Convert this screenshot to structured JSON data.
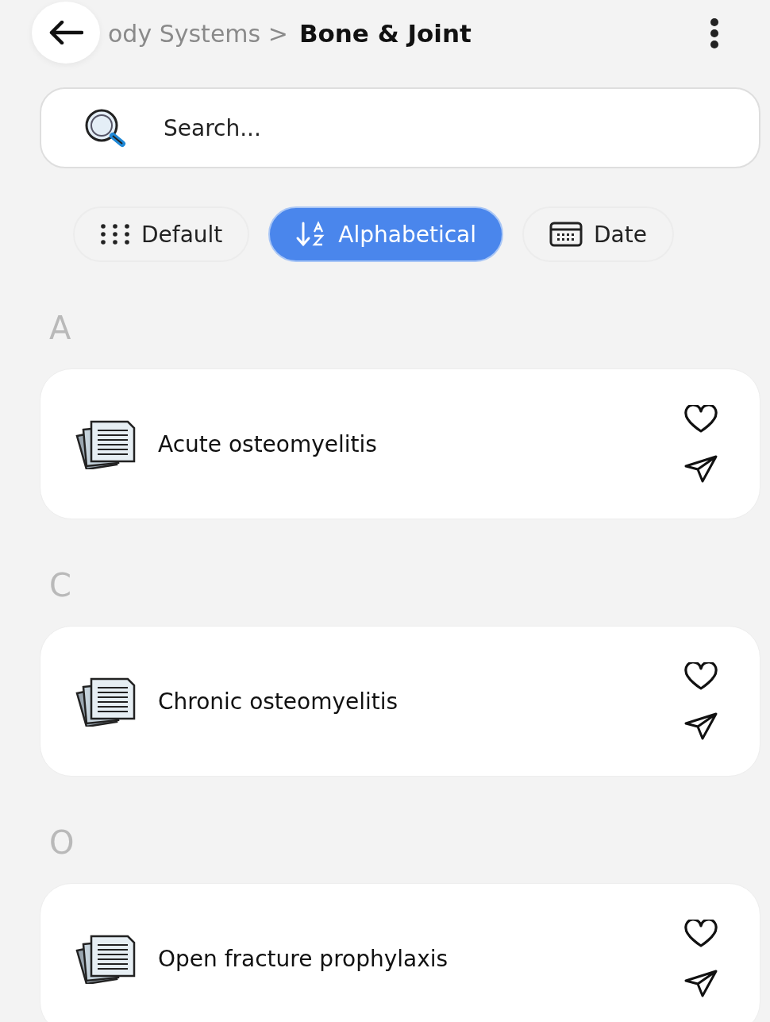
{
  "header": {
    "breadcrumb_parent": "ody Systems >",
    "title": "Bone & Joint"
  },
  "search": {
    "placeholder": "Search..."
  },
  "sort_options": [
    {
      "kind": "default",
      "label": "Default",
      "selected": false
    },
    {
      "kind": "alphabetical",
      "label": "Alphabetical",
      "selected": true
    },
    {
      "kind": "date",
      "label": "Date",
      "selected": false
    }
  ],
  "sections": [
    {
      "letter": "A",
      "items": [
        {
          "title": "Acute osteomyelitis"
        }
      ]
    },
    {
      "letter": "C",
      "items": [
        {
          "title": "Chronic osteomyelitis"
        }
      ]
    },
    {
      "letter": "O",
      "items": [
        {
          "title": "Open fracture prophylaxis"
        }
      ]
    }
  ]
}
